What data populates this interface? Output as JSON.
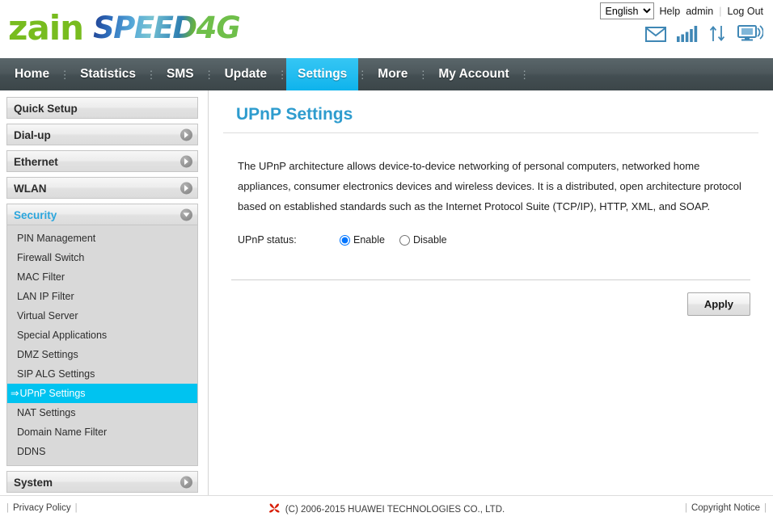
{
  "header": {
    "brand_zain": "zain",
    "brand_speed": "SPEED",
    "brand_4g": "4G",
    "language_value": "English",
    "language_options": [
      "English"
    ],
    "help_label": "Help",
    "user_label": "admin",
    "logout_label": "Log Out",
    "icons": [
      "mail-icon",
      "signal-icon",
      "data-transfer-icon",
      "wifi-monitor-icon"
    ],
    "icon_color": "#3f87b5"
  },
  "nav": {
    "active": "Settings",
    "active_color": "#1bb9ef",
    "items": [
      {
        "label": "Home"
      },
      {
        "label": "Statistics"
      },
      {
        "label": "SMS"
      },
      {
        "label": "Update"
      },
      {
        "label": "Settings"
      },
      {
        "label": "More"
      },
      {
        "label": "My Account"
      }
    ]
  },
  "sidebar": {
    "groups": [
      {
        "label": "Quick Setup",
        "expanded": false,
        "has_chevron": false,
        "items": []
      },
      {
        "label": "Dial-up",
        "expanded": false,
        "has_chevron": true,
        "items": []
      },
      {
        "label": "Ethernet",
        "expanded": false,
        "has_chevron": true,
        "items": []
      },
      {
        "label": "WLAN",
        "expanded": false,
        "has_chevron": true,
        "items": []
      },
      {
        "label": "Security",
        "expanded": true,
        "has_chevron": true,
        "items": [
          {
            "label": "PIN Management",
            "selected": false
          },
          {
            "label": "Firewall Switch",
            "selected": false
          },
          {
            "label": "MAC Filter",
            "selected": false
          },
          {
            "label": "LAN IP Filter",
            "selected": false
          },
          {
            "label": "Virtual Server",
            "selected": false
          },
          {
            "label": "Special Applications",
            "selected": false
          },
          {
            "label": "DMZ Settings",
            "selected": false
          },
          {
            "label": "SIP ALG Settings",
            "selected": false
          },
          {
            "label": "UPnP Settings",
            "selected": true
          },
          {
            "label": "NAT Settings",
            "selected": false
          },
          {
            "label": "Domain Name Filter",
            "selected": false
          },
          {
            "label": "DDNS",
            "selected": false
          }
        ]
      },
      {
        "label": "System",
        "expanded": false,
        "has_chevron": true,
        "items": []
      }
    ],
    "selected_prefix": "⇒",
    "selected_color": "#00c3f0"
  },
  "content": {
    "title": "UPnP Settings",
    "title_color": "#2e9cce",
    "description": "The UPnP architecture allows device-to-device networking of personal computers, networked home appliances, consumer electronics devices and wireless devices. It is a distributed, open architecture protocol based on established standards such as the Internet Protocol Suite (TCP/IP), HTTP, XML, and SOAP.",
    "status_label": "UPnP status:",
    "radio_enable": "Enable",
    "radio_disable": "Disable",
    "selected_status": "Enable",
    "apply_label": "Apply"
  },
  "footer": {
    "privacy_label": "Privacy Policy",
    "copyright_text": "(C) 2006-2015 HUAWEI TECHNOLOGIES CO., LTD.",
    "copyright_notice_label": "Copyright Notice",
    "logo_color": "#d81e05",
    "divider": "|"
  }
}
